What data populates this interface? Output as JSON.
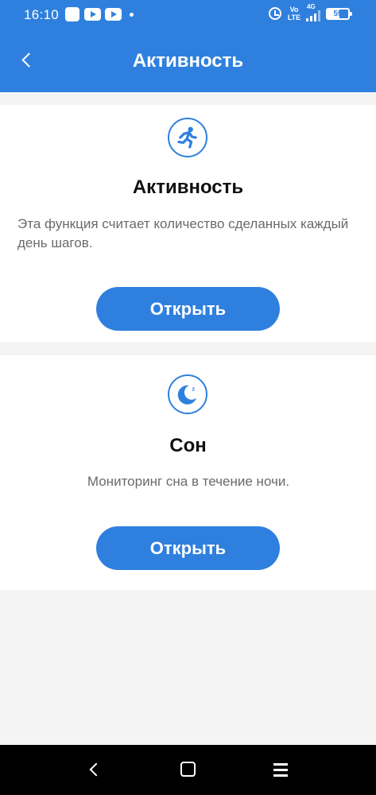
{
  "status_bar": {
    "time": "16:10",
    "volte": "Vo\nLTE",
    "network": "4G",
    "battery_level": "59",
    "battery_fraction": 0.59
  },
  "header": {
    "title": "Активность",
    "back_icon": "chevron-left-icon"
  },
  "cards": [
    {
      "icon": "running-person-icon",
      "title": "Активность",
      "description": "Эта функция считает количество сделанных каждый день шагов.",
      "button_label": "Открыть"
    },
    {
      "icon": "moon-sleep-icon",
      "title": "Сон",
      "description": "Мониторинг сна в течение ночи.",
      "button_label": "Открыть"
    }
  ],
  "nav_bar": {
    "back_icon": "back-triangle-icon",
    "home_icon": "home-square-icon",
    "menu_icon": "menu-lines-icon"
  },
  "colors": {
    "accent": "#2f80de",
    "background": "#f4f4f4",
    "card": "#ffffff",
    "title_text": "#111111",
    "body_text": "#6a6a6a"
  }
}
